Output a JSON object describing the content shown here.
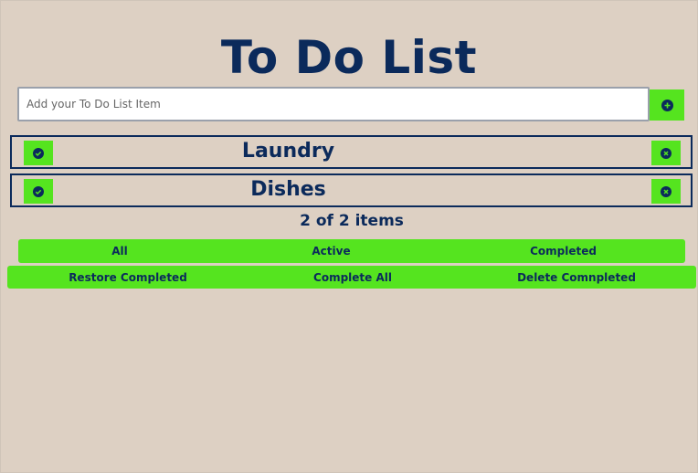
{
  "title": "To Do List",
  "input": {
    "placeholder": "Add your To Do List Item",
    "value": ""
  },
  "add_button": {
    "icon": "plus-circle-icon"
  },
  "items": [
    {
      "label": "Laundry",
      "check_icon": "check-circle-icon",
      "delete_icon": "x-circle-icon"
    },
    {
      "label": "Dishes",
      "check_icon": "check-circle-icon",
      "delete_icon": "x-circle-icon"
    }
  ],
  "count_text": "2 of 2 items",
  "filters": {
    "all": "All",
    "active": "Active",
    "completed": "Completed"
  },
  "actions": {
    "restore": "Restore Completed",
    "complete_all": "Complete All",
    "delete": "Delete Comnpleted"
  },
  "colors": {
    "background": "#ddd0c3",
    "accent": "#55e41f",
    "text": "#0b2a5b"
  }
}
